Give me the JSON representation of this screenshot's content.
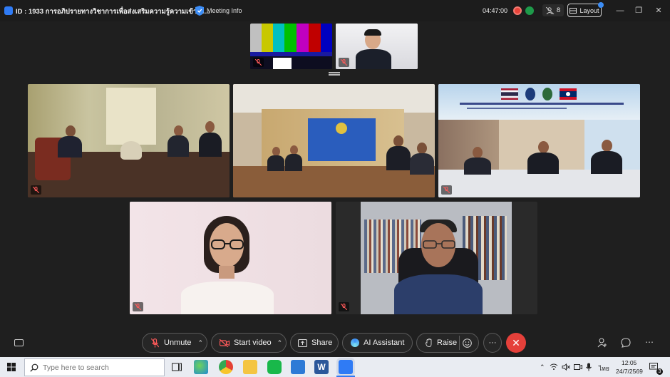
{
  "topbar": {
    "meeting_title": "ID : 1933 การอภิปรายทางวิชาการเพื่อส่งเสริมความรู้ความเข้าใจ...",
    "meeting_info": "Meeting Info",
    "timer": "04:47:00",
    "participants_count": "8",
    "layout_label": "Layout"
  },
  "toolbar": {
    "unmute": "Unmute",
    "start_video": "Start video",
    "share": "Share",
    "ai_assistant": "AI Assistant",
    "raise": "Raise",
    "more": "···"
  },
  "taskbar": {
    "search_placeholder": "Type here to search",
    "language": "ไทย",
    "time": "12:05",
    "date": "24/7/2569",
    "notifications": "3"
  },
  "colors": {
    "accent": "#2f7bf5",
    "end_call": "#e5403a",
    "recording": "#e8443a",
    "background": "#1f1f1f"
  }
}
